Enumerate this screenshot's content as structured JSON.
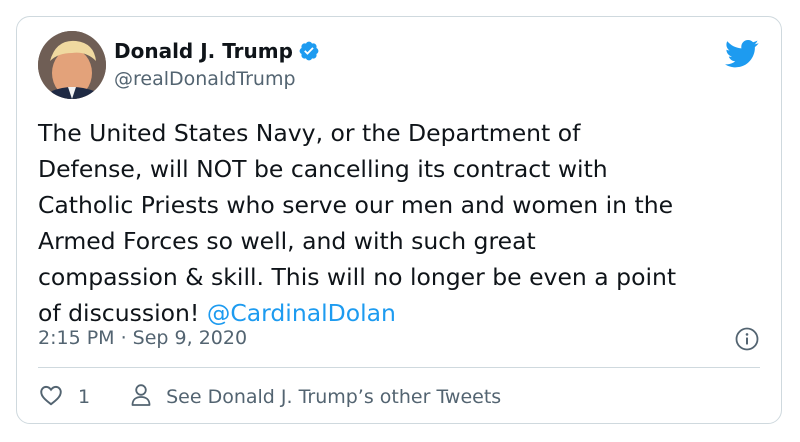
{
  "author": {
    "name": "Donald J. Trump",
    "handle": "@realDonaldTrump",
    "verified_icon": "verified-badge-icon",
    "avatar": "profile-photo"
  },
  "tweet": {
    "text": "The United States Navy, or the Department of\nDefense, will NOT be cancelling its contract with\nCatholic Priests who serve our men and women in the\nArmed Forces so well, and with such great\ncompassion & skill. This will no longer be even a point\nof discussion! ",
    "mention": "@CardinalDolan",
    "timestamp": "2:15 PM · Sep 9, 2020"
  },
  "actions": {
    "like_count": "1",
    "other_tweets_label": "See Donald J. Trump’s other Tweets"
  },
  "colors": {
    "accent": "#1d9bf0",
    "secondary_text": "#536471",
    "border": "#cfd9de"
  },
  "icons": [
    "twitter-bird-icon",
    "verified-badge-icon",
    "info-icon",
    "heart-icon",
    "person-icon"
  ]
}
